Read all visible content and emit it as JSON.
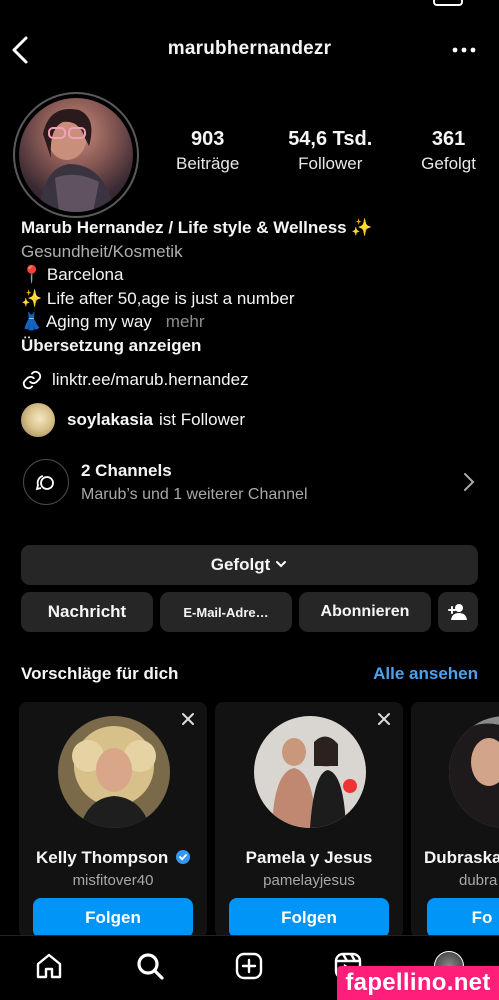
{
  "header": {
    "username": "marubhernandezr",
    "back_icon": "chevron-left-icon",
    "more_icon": "more-dots-icon"
  },
  "stats": [
    {
      "value": "903",
      "label": "Beiträge"
    },
    {
      "value": "54,6 Tsd.",
      "label": "Follower"
    },
    {
      "value": "361",
      "label": "Gefolgt"
    }
  ],
  "bio": {
    "name": "Marub Hernandez / Life style & Wellness ✨",
    "category": "Gesundheit/Kosmetik",
    "line1": "📍 Barcelona",
    "line2": "✨ Life after 50,age is just a number",
    "line3": "👗 Aging my way",
    "more": "mehr",
    "translate": "Übersetzung anzeigen"
  },
  "link": {
    "url": "linktr.ee/marub.hernandez",
    "icon": "link-icon"
  },
  "followed_by": {
    "user": "soylakasia",
    "suffix": "ist Follower"
  },
  "channels": {
    "title": "2 Channels",
    "subtitle": "Marub’s und 1 weiterer Channel",
    "icon": "channels-icon"
  },
  "buttons": {
    "following": "Gefolgt",
    "message": "Nachricht",
    "email": "E-Mail-Adre…",
    "subscribe": "Abonnieren",
    "add_person_icon": "add-person-icon"
  },
  "suggestions": {
    "title": "Vorschläge für dich",
    "see_all": "Alle ansehen",
    "cards": [
      {
        "name": "Kelly Thompson",
        "handle": "misfitover40",
        "verified": true,
        "button": "Folgen"
      },
      {
        "name": "Pamela y Jesus",
        "handle": "pamelayjesus",
        "verified": false,
        "button": "Folgen"
      },
      {
        "name": "Dubraska",
        "handle": "dubra",
        "verified": false,
        "button": "Fo"
      }
    ]
  },
  "tabbar": {
    "icons": [
      "home-icon",
      "search-icon",
      "create-icon",
      "reels-icon",
      "profile-avatar"
    ]
  },
  "watermark": "fapellino.net",
  "colors": {
    "background": "#000000",
    "button_dark": "#262626",
    "accent_blue": "#0095f6",
    "link_blue": "#4aa3f0",
    "watermark_pink": "#ff1f7a"
  }
}
